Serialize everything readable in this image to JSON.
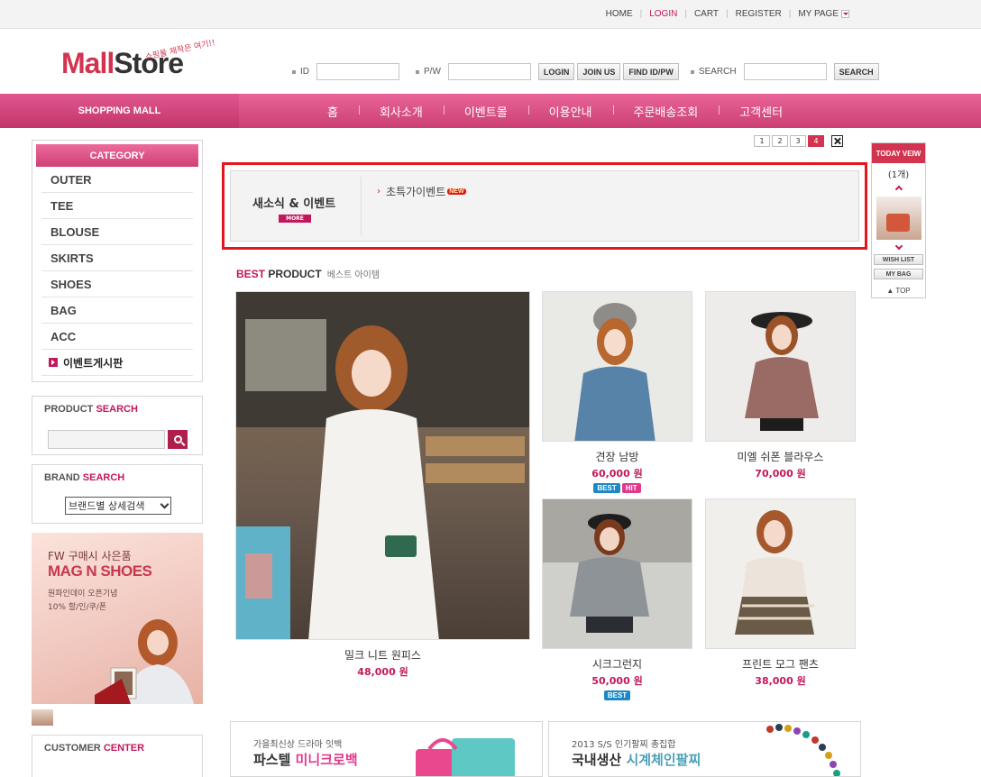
{
  "topnav": {
    "home": "HOME",
    "login": "LOGIN",
    "cart": "CART",
    "register": "REGISTER",
    "mypage": "MY PAGE"
  },
  "header": {
    "logo_mall": "Mall",
    "logo_store": "Store",
    "logo_tagline": "쇼핑몰 제작은 여기!!",
    "id_label": "ID",
    "pw_label": "P/W",
    "login_btn": "LOGIN",
    "join_btn": "JOIN US",
    "find_btn": "FIND ID/PW",
    "search_label": "SEARCH",
    "search_btn": "SEARCH"
  },
  "mainnav": {
    "shopping_mall": "SHOPPING MALL",
    "items": [
      "홈",
      "회사소개",
      "이벤트몰",
      "이용안내",
      "주문배송조회",
      "고객센터"
    ]
  },
  "sidebar": {
    "category_title": "CATEGORY",
    "categories": [
      "OUTER",
      "TEE",
      "BLOUSE",
      "SKIRTS",
      "SHOES",
      "BAG",
      "ACC"
    ],
    "event_board": "이벤트게시판",
    "product_search_a": "PRODUCT ",
    "product_search_b": "SEARCH",
    "brand_search_a": "BRAND ",
    "brand_search_b": "SEARCH",
    "brand_select": "브랜드별 상세검색",
    "banner_line1": "FW 구매시 사은품",
    "banner_line2": "MAG N SHOES",
    "banner_line3": "원파인데이 오픈기념",
    "banner_line4": "10% 할/인/쿠/폰",
    "customer_a": "CUSTOMER ",
    "customer_b": "CENTER"
  },
  "notice": {
    "title": "새소식 & 이벤트",
    "more": "MORE",
    "item": "초특가이벤트",
    "new_badge": "NEW"
  },
  "pager": {
    "pages": [
      "1",
      "2",
      "3",
      "4"
    ],
    "active_page": "4"
  },
  "today": {
    "title": "TODAY VEIW",
    "count": "(1개)",
    "wishlist": "WISH LIST",
    "mybag": "MY BAG",
    "top": "TOP"
  },
  "best": {
    "title_a": "BEST",
    "title_b": " PRODUCT",
    "subtitle": "베스트 아이템",
    "products": [
      {
        "name": "밀크 니트 원피스",
        "price": "48,000 원",
        "badges": []
      },
      {
        "name": "견장 남방",
        "price": "60,000 원",
        "badges": [
          "BEST",
          "HIT"
        ]
      },
      {
        "name": "미엘 쉬폰 블라우스",
        "price": "70,000 원",
        "badges": []
      },
      {
        "name": "시크그런지",
        "price": "50,000 원",
        "badges": [
          "BEST"
        ]
      },
      {
        "name": "프린트 모그 팬츠",
        "price": "38,000 원",
        "badges": []
      }
    ]
  },
  "bottom_banners": [
    {
      "line1": "가을최신상 드라마 잇백",
      "line2a": "파스텔 ",
      "line2b": "미니크로백"
    },
    {
      "line1": "2013 S/S 인기팔찌 총집합",
      "line2a": "국내생산 ",
      "line2b": "시계체인팔찌"
    }
  ],
  "colors": {
    "accent": "#c2185b",
    "nav_pink": "#d94a80",
    "notice_border": "#e3151f"
  }
}
